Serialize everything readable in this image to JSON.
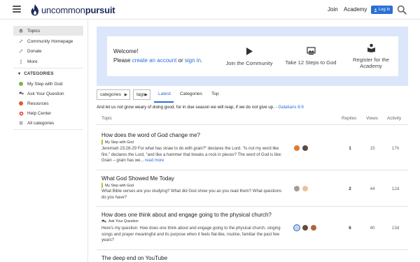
{
  "header": {
    "logo": {
      "prefix": "uncommon",
      "suffix": "pursuit"
    },
    "links": [
      "Join",
      "Academy"
    ],
    "login_label": "Log In"
  },
  "sidebar": {
    "items": [
      {
        "label": "Topics",
        "icon": "layers-icon",
        "active": true
      },
      {
        "label": "Community Homepage",
        "icon": "link-icon"
      },
      {
        "label": "Donate",
        "icon": "link-icon"
      },
      {
        "label": "More",
        "icon": "more-vertical-icon"
      }
    ],
    "categories_heading": "CATEGORIES",
    "categories": [
      {
        "label": "My Step with God",
        "color": "#7ab648"
      },
      {
        "label": "Ask Your Question",
        "color": "#555555",
        "icon": "chat-icon"
      },
      {
        "label": "Resources",
        "color": "#e4572e"
      },
      {
        "label": "Help Center",
        "color": "#d9412b",
        "icon": "lifebuoy-icon"
      },
      {
        "label": "All categories",
        "icon": "list-icon"
      }
    ]
  },
  "banner": {
    "welcome": "Welcome!",
    "line2_prefix": "Please ",
    "create_link": "create an account",
    "line2_mid": " or ",
    "signin_link": "sign in",
    "line2_suffix": ".",
    "actions": [
      {
        "label": "Join the Community",
        "icon": "play-icon"
      },
      {
        "label": "Take 12 Steps to God",
        "icon": "image-icon"
      },
      {
        "label_1": "Register for the",
        "label_2": "Academy",
        "icon": "book-icon"
      }
    ]
  },
  "nav": {
    "categories_dd": "categories",
    "tags_dd": "tags",
    "tabs": [
      "Latest",
      "Categories",
      "Top"
    ],
    "active_tab": "Latest"
  },
  "verse": {
    "text": "And let us not grow weary of doing good, for in due season we will reap, if we do not give up. - ",
    "ref": "Galatians 6:9"
  },
  "table": {
    "headers": {
      "topic": "Topic",
      "replies": "Replies",
      "views": "Views",
      "activity": "Activity"
    }
  },
  "topics": [
    {
      "title": "How does the word of God change me?",
      "category": "My Step with God",
      "cat_color": "#a3c93a",
      "excerpt": "Jeremiah 23:28-29 For what has straw to do with grain?\" declares the Lord. \"Is not my word like fire,\" declares the Lord, \"and like a hammer that breaks a rock in pieces? The word of God is like: Grain – grain has we...",
      "read_more": "read more",
      "replies": "1",
      "views": "15",
      "activity": "17h"
    },
    {
      "title": "What God Showed Me Today",
      "category": "My Step with God",
      "cat_color": "#a3c93a",
      "excerpt": "What Bible verses are you studying? What did God show you as you read them? What questions do you have?",
      "replies": "2",
      "views": "44",
      "activity": "12d"
    },
    {
      "title": "How does one think about and engage going to the physical church?",
      "category": "Ask Your Question",
      "excerpt": "Here's my question: How does one think about and engage going to the physical church, singing songs and prayer meaningful and its purpose when it feels flat-like, routine, familiar the past few years?",
      "replies": "6",
      "views": "40",
      "activity": "13d"
    },
    {
      "title": "The deep end on YouTube"
    }
  ]
}
